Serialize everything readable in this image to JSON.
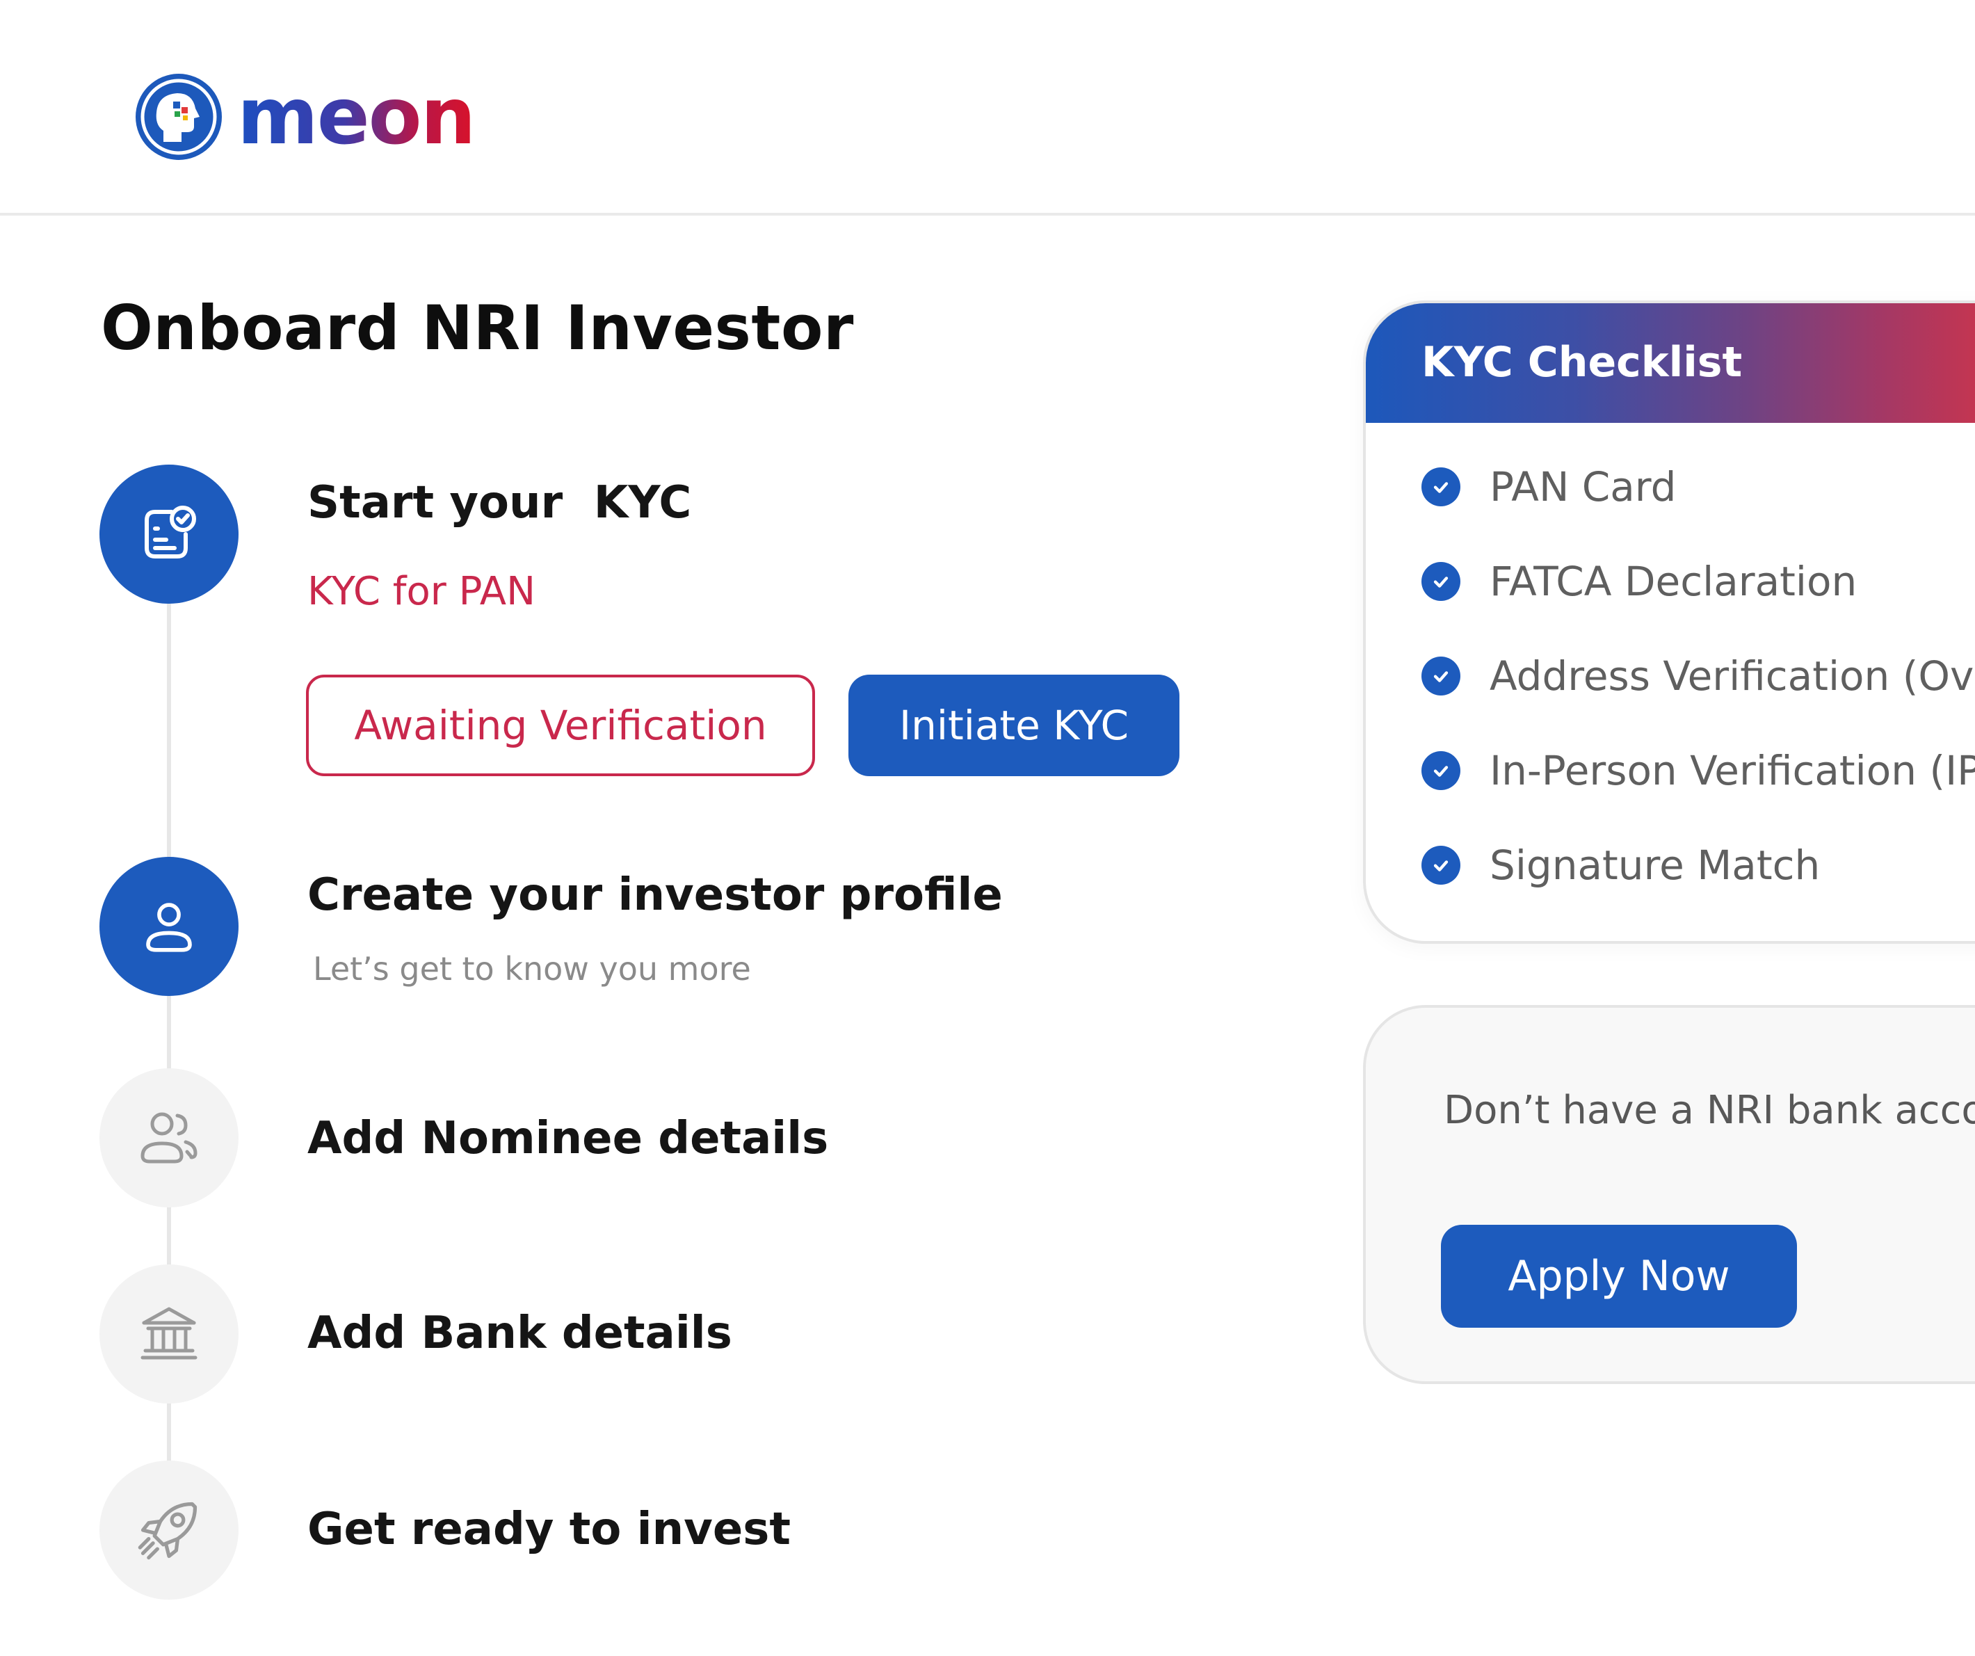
{
  "brand": {
    "name": "meon",
    "colors": {
      "primary": "#1d5bbd",
      "accent_red": "#c9284c"
    }
  },
  "page": {
    "title": "Onboard NRI Investor"
  },
  "steps": [
    {
      "title": "Start your  KYC",
      "subtitle": "KYC for PAN",
      "icon": "kyc-document-check-icon",
      "state": "active"
    },
    {
      "title": "Create your investor profile",
      "subtitle": "Let’s get to know you more",
      "icon": "user-icon",
      "state": "active"
    },
    {
      "title": "Add Nominee details",
      "icon": "users-icon",
      "state": "inactive"
    },
    {
      "title": "Add Bank details",
      "icon": "bank-icon",
      "state": "inactive"
    },
    {
      "title": "Get ready to invest",
      "icon": "rocket-icon",
      "state": "inactive"
    }
  ],
  "kyc_actions": {
    "status_label": "Awaiting Verification",
    "initiate_label": "Initiate KYC"
  },
  "checklist": {
    "title": "KYC Checklist",
    "items": [
      "PAN Card",
      "FATCA Declaration",
      "Address Verification (Ove",
      "In-Person Verification (IP",
      "Signature Match"
    ]
  },
  "bank_prompt": {
    "text": "Don’t have a NRI bank acco",
    "button_label": "Apply Now"
  }
}
